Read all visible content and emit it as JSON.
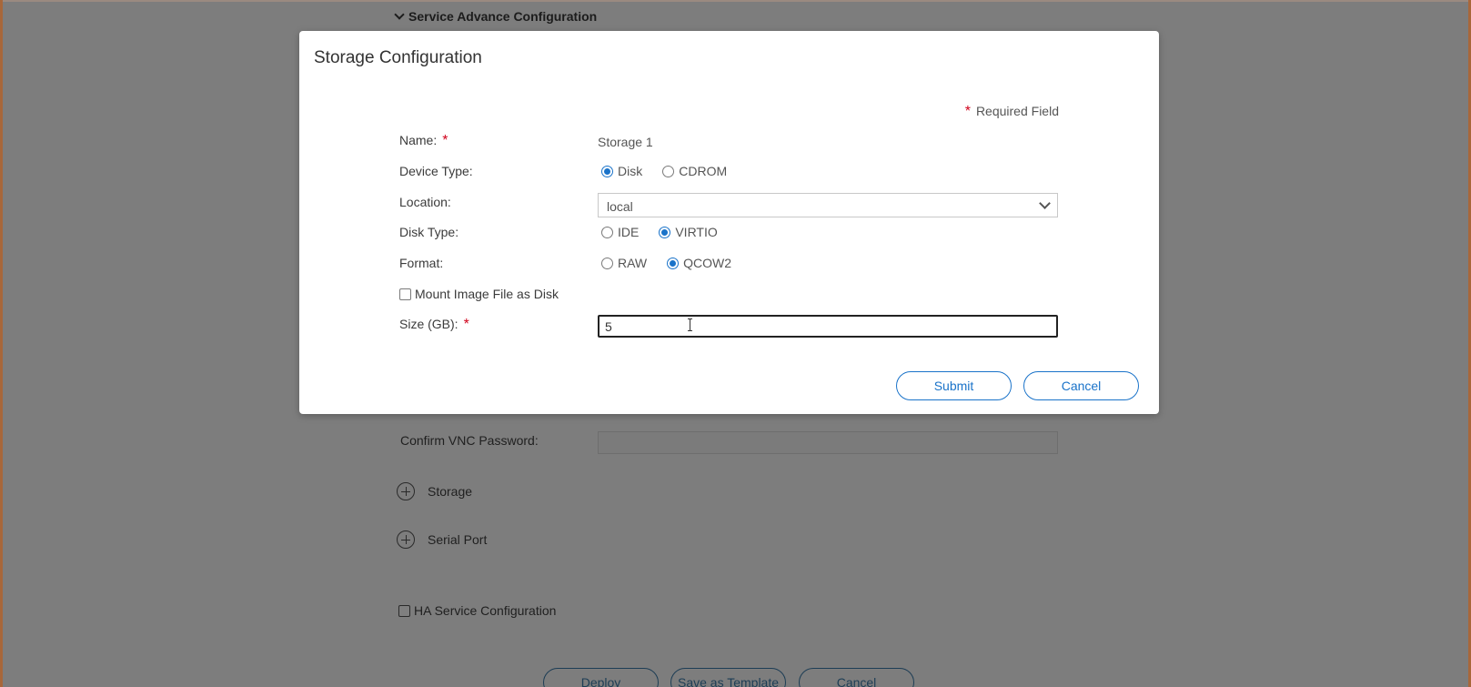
{
  "background_page": {
    "section_title": "Service Advance Configuration",
    "confirm_vnc_label": "Confirm VNC Password:",
    "confirm_vnc_value": "",
    "storage_label": "Storage",
    "serial_port_label": "Serial Port",
    "ha_service_label": "HA Service Configuration",
    "ha_service_checked": false,
    "buttons": {
      "deploy": "Deploy",
      "save_template": "Save as Template",
      "cancel": "Cancel"
    }
  },
  "modal": {
    "title": "Storage Configuration",
    "required_note": "Required Field",
    "required_marker": "*",
    "fields": {
      "name": {
        "label": "Name:",
        "value": "Storage 1",
        "required": true
      },
      "device_type": {
        "label": "Device Type:",
        "options": [
          "Disk",
          "CDROM"
        ],
        "selected": "Disk"
      },
      "location": {
        "label": "Location:",
        "value": "local"
      },
      "disk_type": {
        "label": "Disk Type:",
        "options": [
          "IDE",
          "VIRTIO"
        ],
        "selected": "VIRTIO"
      },
      "format": {
        "label": "Format:",
        "options": [
          "RAW",
          "QCOW2"
        ],
        "selected": "QCOW2"
      },
      "mount_image": {
        "label": "Mount Image File as Disk",
        "checked": false
      },
      "size": {
        "label": "Size (GB):",
        "value": "5",
        "required": true
      }
    },
    "buttons": {
      "submit": "Submit",
      "cancel": "Cancel"
    }
  },
  "colors": {
    "accent": "#1a73c9",
    "required": "#d0021b",
    "overlay": "#7d7d7d"
  }
}
